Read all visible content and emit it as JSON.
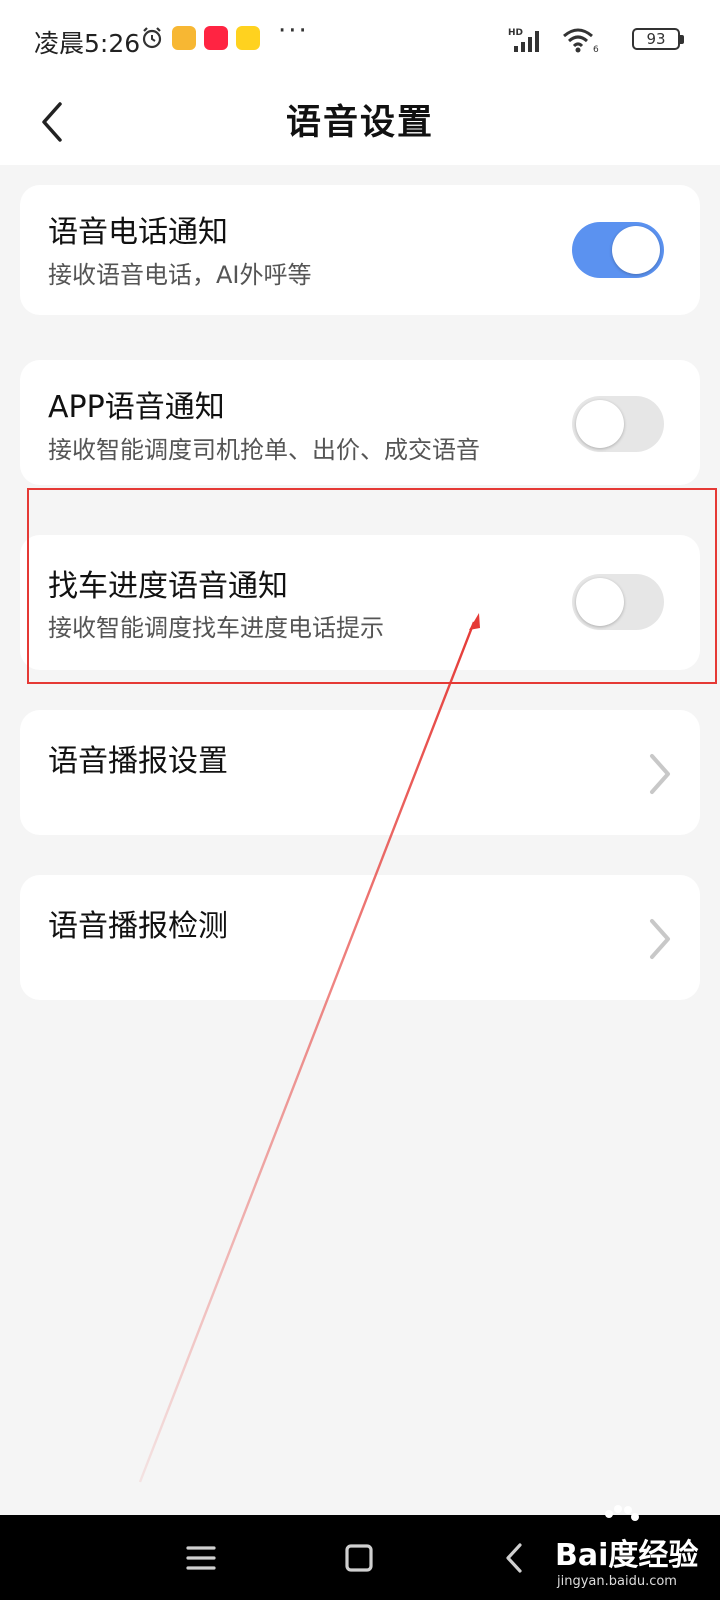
{
  "status_bar": {
    "time": "凌晨5:26",
    "more": "···",
    "battery": "93",
    "network": "HD",
    "wifi_badge": "6"
  },
  "header": {
    "title": "语音设置"
  },
  "settings": [
    {
      "title": "语音电话通知",
      "subtitle": "接收语音电话，AI外呼等",
      "toggle_on": true
    },
    {
      "title": "APP语音通知",
      "subtitle": "接收智能调度司机抢单、出价、成交语音",
      "toggle_on": false
    },
    {
      "title": "找车进度语音通知",
      "subtitle": "接收智能调度找车进度电话提示",
      "toggle_on": false
    }
  ],
  "links": [
    {
      "title": "语音播报设置"
    },
    {
      "title": "语音播报检测"
    }
  ],
  "colors": {
    "accent": "#5b92f0",
    "annotation": "#e53935",
    "background": "#f5f5f5"
  },
  "watermark": {
    "brand": "Bai度经验",
    "url": "jingyan.baidu.com"
  }
}
